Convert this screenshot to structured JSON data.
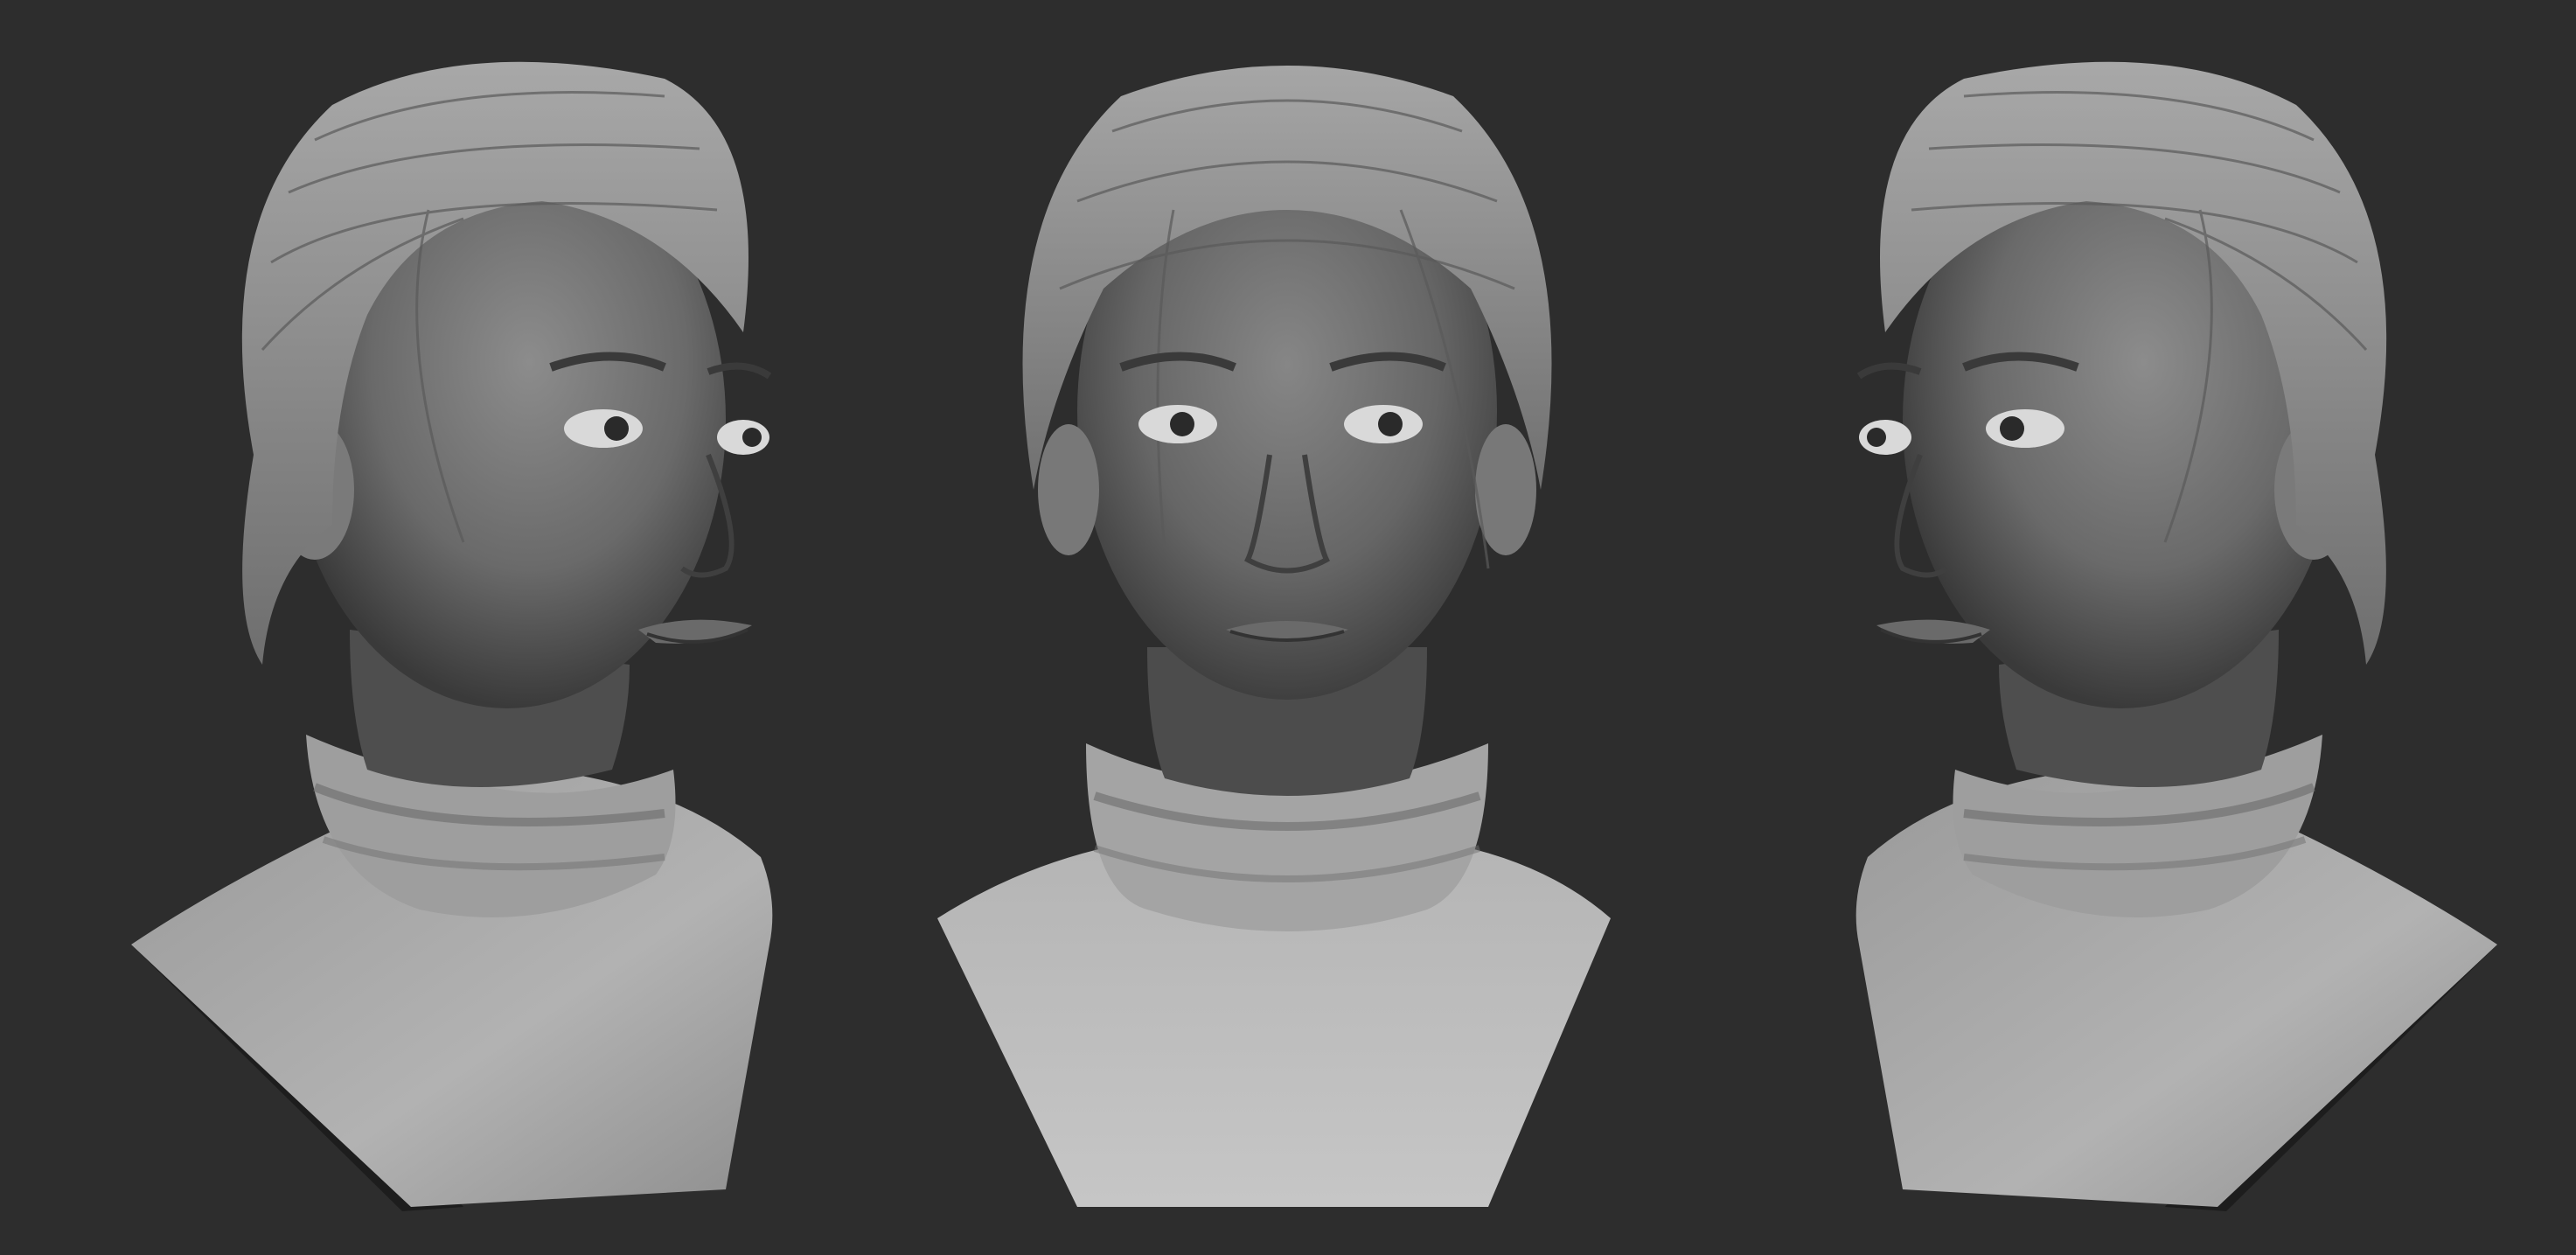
{
  "scene": {
    "background_color": "#2d2d2d",
    "material_color": "#8e8e8e",
    "highlight_color": "#c8c8c8",
    "shadow_color": "#262626",
    "views": [
      {
        "id": "left",
        "label": "three-quarter-left",
        "icon": "sculpt-bust-three-quarter"
      },
      {
        "id": "front",
        "label": "front",
        "icon": "sculpt-bust-front"
      },
      {
        "id": "right",
        "label": "three-quarter-right",
        "icon": "sculpt-bust-three-quarter"
      }
    ]
  }
}
